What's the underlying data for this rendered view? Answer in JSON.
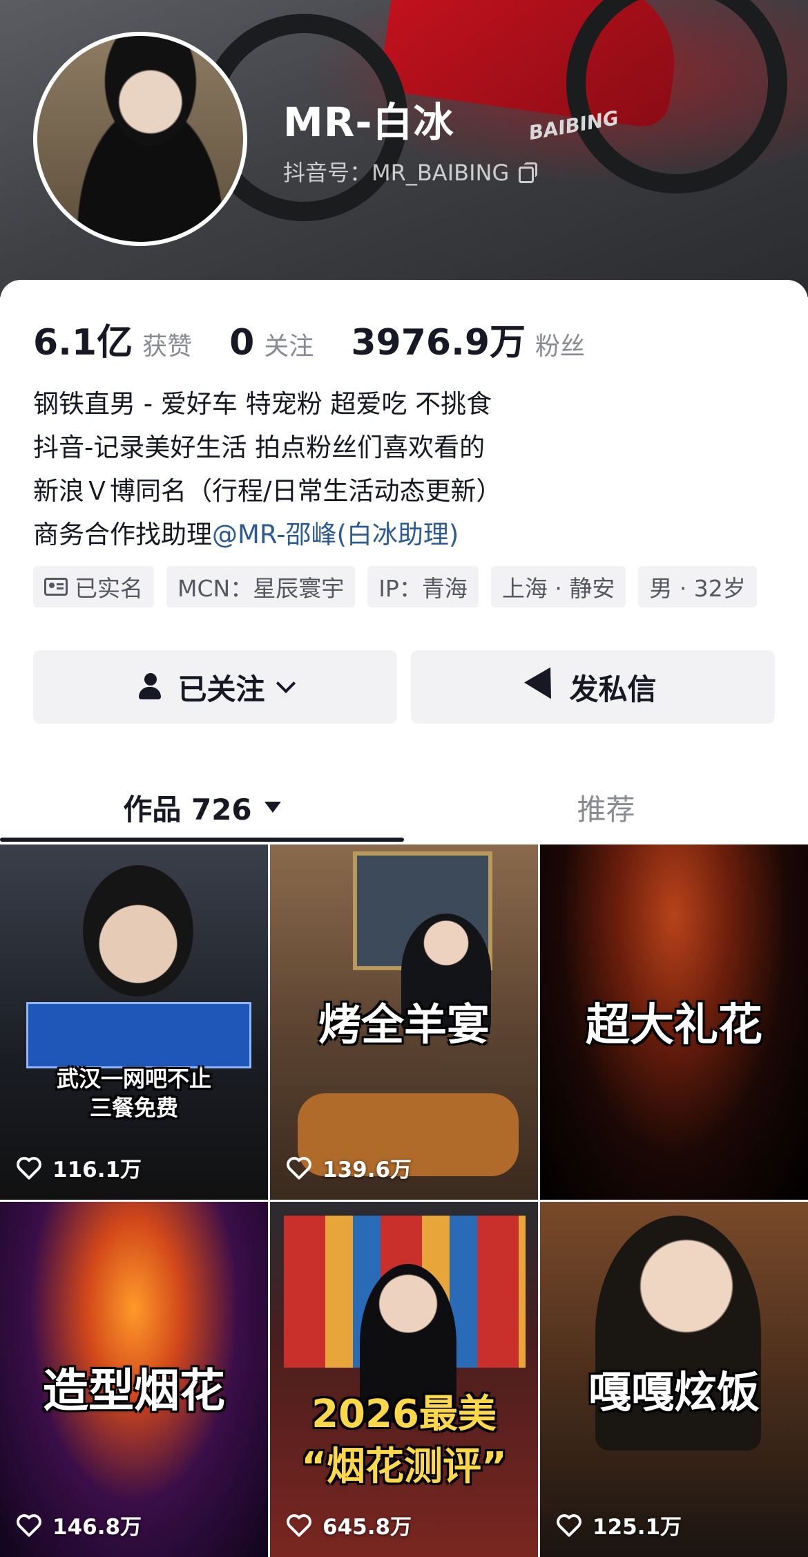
{
  "profile": {
    "name": "MR-白冰",
    "douyin_id": "抖音号：MR_BAIBING",
    "bike_brand": "BAIBING"
  },
  "stats": [
    {
      "value": "6.1亿",
      "label": "获赞"
    },
    {
      "value": "0",
      "label": "关注"
    },
    {
      "value": "3976.9万",
      "label": "粉丝"
    }
  ],
  "bio": {
    "line1": "钢铁直男 - 爱好车 特宠粉 超爱吃 不挑食",
    "line2": "抖音-记录美好生活 拍点粉丝们喜欢看的",
    "line3": "新浪Ｖ博同名（行程/日常生活动态更新）",
    "line4_prefix": "商务合作找助理",
    "line4_mention": "@MR-邵峰(白冰助理)"
  },
  "tags": {
    "verified": "已实名",
    "mcn": "MCN：星辰寰宇",
    "ip": "IP：青海",
    "location": "上海 · 静安",
    "gender_age": "男 · 32岁"
  },
  "buttons": {
    "followed": "已关注",
    "message": "发私信"
  },
  "tabs": {
    "works": "作品 726",
    "recommended": "推荐"
  },
  "videos": [
    {
      "title": "武汉一网吧不止\n三餐免费",
      "likes": "116.1万"
    },
    {
      "title": "烤全羊宴",
      "likes": "139.6万"
    },
    {
      "title": "超大礼花",
      "likes": ""
    },
    {
      "title": "造型烟花",
      "likes": "146.8万"
    },
    {
      "title": "2026最美\n“烟花测评”",
      "likes": "645.8万"
    },
    {
      "title": "嘎嘎炫饭",
      "likes": "125.1万"
    }
  ],
  "colors": {
    "text_primary": "#161823",
    "text_secondary": "#888a93",
    "mention": "#2b5a95",
    "button_bg": "#f2f2f4",
    "tag_bg": "#f2f2f4"
  }
}
